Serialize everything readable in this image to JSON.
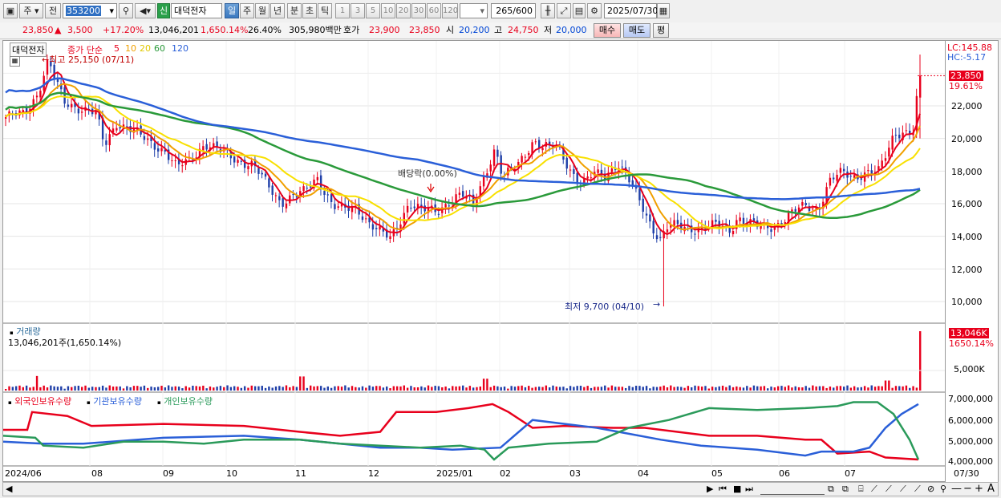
{
  "toolbar": {
    "market": "주",
    "prev_label": "전",
    "code": "353200",
    "stock_name": "대덕전자",
    "new_badge": "신",
    "periods": [
      "일",
      "주",
      "월",
      "년",
      "분",
      "초",
      "틱"
    ],
    "active_period": "일",
    "intervals": [
      "1",
      "3",
      "5",
      "10",
      "20",
      "30",
      "60",
      "120"
    ],
    "count": "265",
    "count_total": "/600",
    "date": "2025/07/30"
  },
  "info": {
    "price": "23,850",
    "change_arrow": "▲",
    "change": "3,500",
    "change_pct": "+17.20%",
    "volume": "13,046,201",
    "volume_pct": "1,650.14%",
    "turnover": "26.40%",
    "amount": "305,980백만",
    "ask_label": "호가",
    "ask": "23,900",
    "bid": "23,850",
    "open_label": "시",
    "open": "20,200",
    "high_label": "고",
    "high": "24,750",
    "low_label": "저",
    "low": "20,000",
    "buy_label": "매수",
    "sell_label": "매도",
    "eval_label": "평"
  },
  "price_panel": {
    "title": "대덕전자",
    "legend_prefix": "종가 단순",
    "ma_periods": [
      "5",
      "10",
      "20",
      "60",
      "120"
    ],
    "ma_colors": [
      "#e8001c",
      "#f0a000",
      "#f8e000",
      "#2a9a3a",
      "#2a5fd8"
    ],
    "max_label": "←최고 25,150 (07/11)",
    "min_label": "최저 9,700 (04/10)",
    "min_arrow": "→",
    "dividend_label": "배당락(0.00%)",
    "lc": "LC:145.88",
    "hc": "HC:-5.17",
    "current_price_tag": "23,850",
    "current_pct_tag": "19.61%",
    "y_ticks": [
      "22,000",
      "20,000",
      "18,000",
      "16,000",
      "14,000",
      "12,000",
      "10,000"
    ]
  },
  "volume_panel": {
    "title": "거래량",
    "value": "13,046,201주(1,650.14%)",
    "tag": "13,046K",
    "tag_pct": "1650.14%",
    "y_tick": "5,000K"
  },
  "holding_panel": {
    "legend": [
      "외국인보유수량",
      "기관보유수량",
      "개인보유수량"
    ],
    "colors": [
      "#e8001c",
      "#2a5fd8",
      "#2a9a5a"
    ],
    "y_ticks": [
      "7,000,000",
      "6,000,000",
      "5,000,000",
      "4,000,000"
    ]
  },
  "x_axis": [
    "2024/06",
    "08",
    "09",
    "10",
    "11",
    "12",
    "2025/01",
    "02",
    "03",
    "04",
    "05",
    "06",
    "07",
    "07/30"
  ],
  "chart_data": {
    "type": "candlestick",
    "title": "대덕전자",
    "price_range": [
      9700,
      25150
    ],
    "last_close": 23850,
    "last_volume": 13046201,
    "ma_periods": [
      5,
      10,
      20,
      60,
      120
    ],
    "holding_series": [
      "외국인보유수량",
      "기관보유수량",
      "개인보유수량"
    ],
    "holding_ylim": [
      4000000,
      7000000
    ]
  }
}
